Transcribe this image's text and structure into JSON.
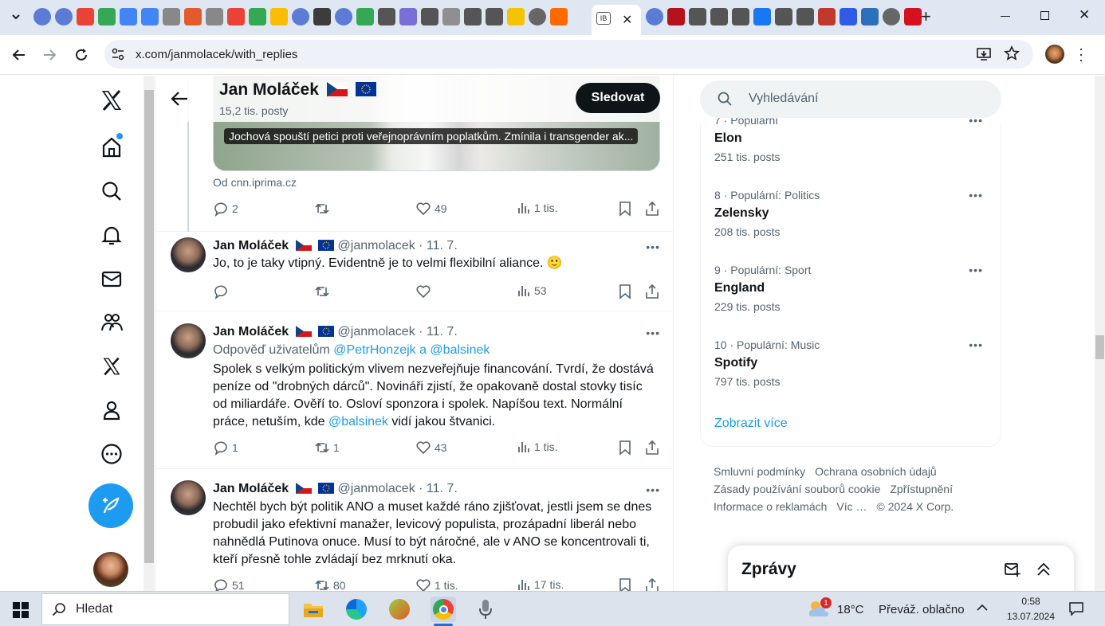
{
  "browser": {
    "url": "x.com/janmolacek/with_replies",
    "tab_favicons": [
      {
        "icon": "globe-icon",
        "color": "#5b7bd5"
      },
      {
        "icon": "globe-icon",
        "color": "#5b7bd5"
      },
      {
        "icon": "gmail-icon",
        "color": "#ea4335"
      },
      {
        "icon": "drive-icon",
        "color": "#34a853"
      },
      {
        "icon": "docs-icon",
        "color": "#4285f4"
      },
      {
        "icon": "docs-icon",
        "color": "#4285f4"
      },
      {
        "icon": "site-icon",
        "color": "#888888"
      },
      {
        "icon": "site-icon",
        "color": "#e35b2d"
      },
      {
        "icon": "site-icon",
        "color": "#888888"
      },
      {
        "icon": "gmail-icon",
        "color": "#ea4335"
      },
      {
        "icon": "drive-icon",
        "color": "#34a853"
      },
      {
        "icon": "drive-icon",
        "color": "#fbbc04"
      },
      {
        "icon": "globe-icon",
        "color": "#5b7bd5"
      },
      {
        "icon": "site-icon",
        "color": "#3c3c3c"
      },
      {
        "icon": "globe-icon",
        "color": "#5b7bd5"
      },
      {
        "icon": "drive-icon",
        "color": "#34a853"
      },
      {
        "icon": "site-icon",
        "color": "#555555"
      },
      {
        "icon": "site-icon",
        "color": "#7a6fd6"
      },
      {
        "icon": "site-icon",
        "color": "#555555"
      },
      {
        "icon": "site-icon",
        "color": "#8f8f8f"
      },
      {
        "icon": "site-icon",
        "color": "#555555"
      },
      {
        "icon": "site-icon",
        "color": "#555555"
      },
      {
        "icon": "site-icon",
        "color": "#f5c400"
      },
      {
        "icon": "globe-icon",
        "color": "#666666"
      },
      {
        "icon": "site-icon",
        "color": "#ff6a00"
      }
    ],
    "tab_favicons_right": [
      {
        "icon": "globe-icon",
        "color": "#5b7bd5"
      },
      {
        "icon": "site-icon",
        "color": "#b5121b"
      },
      {
        "icon": "site-icon",
        "color": "#555555"
      },
      {
        "icon": "site-icon",
        "color": "#555555"
      },
      {
        "icon": "site-icon",
        "color": "#555555"
      },
      {
        "icon": "facebook-icon",
        "color": "#1877f2"
      },
      {
        "icon": "site-icon",
        "color": "#555555"
      },
      {
        "icon": "site-icon",
        "color": "#555555"
      },
      {
        "icon": "site-icon",
        "color": "#c0392b"
      },
      {
        "icon": "site-icon",
        "color": "#2f5be6"
      },
      {
        "icon": "site-icon",
        "color": "#2c6fbb"
      },
      {
        "icon": "globe-icon",
        "color": "#666666"
      },
      {
        "icon": "site-icon",
        "color": "#d4121d"
      }
    ],
    "active_tab_label": "IB",
    "add_tab": "+"
  },
  "profile": {
    "name": "Jan Moláček",
    "posts": "15,2 tis. posty",
    "follow_label": "Sledovat"
  },
  "link_card": {
    "caption": "Jochová spouští petici proti veřejnoprávním poplatkům. Zmínila i transgender ak...",
    "source": "Od cnn.iprima.cz",
    "replies": "2",
    "likes": "49",
    "views": "1 tis."
  },
  "tweets": [
    {
      "name": "Jan Moláček",
      "handle": "@janmolacek",
      "date": "· 11. 7.",
      "text": "Jo, to je taky vtipný. Evidentně je to velmi flexibilní aliance. 🙂",
      "replies": "",
      "reposts": "",
      "likes": "",
      "views": "53"
    },
    {
      "name": "Jan Moláček",
      "handle": "@janmolacek",
      "date": "· 11. 7.",
      "reply_prefix": "Odpověď uživatelům",
      "reply_to": "@PetrHonzejk a @balsinek",
      "text_a": "Spolek s velkým politickým vlivem nezveřejňuje financování. Tvrdí, že dostává peníze od \"drobných dárců\". Novináři zjistí, že opakovaně dostal stovky tisíc od miliardáře. Ověří to. Osloví sponzora i spolek. Napíšou text. Normální práce, netuším, kde ",
      "mention": "@balsinek",
      "text_b": " vidí jakou štvanici.",
      "replies": "1",
      "reposts": "1",
      "likes": "43",
      "views": "1 tis."
    },
    {
      "name": "Jan Moláček",
      "handle": "@janmolacek",
      "date": "· 11. 7.",
      "text": "Nechtěl bych být politik ANO a muset každé ráno zjišťovat, jestli jsem se dnes probudil jako efektivní manažer, levicový populista, prozápadní liberál nebo nahnědlá Putinova onuce. Musí to být náročné, ale v ANO se koncentrovali ti, kteří přesně tohle zvládají bez mrknutí oka.",
      "replies": "51",
      "reposts": "80",
      "likes": "1 tis.",
      "views": "17 tis."
    }
  ],
  "search": {
    "placeholder": "Vyhledávání"
  },
  "trends": [
    {
      "meta": "7 · Populární",
      "name": "Elon",
      "count": "251 tis. posts"
    },
    {
      "meta": "8 · Populární: Politics",
      "name": "Zelensky",
      "count": "208 tis. posts"
    },
    {
      "meta": "9 · Populární: Sport",
      "name": "England",
      "count": "229 tis. posts"
    },
    {
      "meta": "10 · Populární: Music",
      "name": "Spotify",
      "count": "797 tis. posts"
    }
  ],
  "show_more": "Zobrazit více",
  "footer": {
    "terms": "Smluvní podmínky",
    "privacy": "Ochrana osobních údajů",
    "cookies": "Zásady používání souborů cookie",
    "accessibility": "Zpřístupnění",
    "ads": "Informace o reklamách",
    "more": "Víc …",
    "copyright": "© 2024 X Corp."
  },
  "messages": {
    "title": "Zprávy"
  },
  "taskbar": {
    "search": "Hledat",
    "weather_temp": "18°C",
    "weather_text": "Převáž. oblačno",
    "weather_badge": "1",
    "time": "0:58",
    "date": "13.07.2024"
  },
  "colors": {
    "accent": "#1d9bf0",
    "text": "#0f1419",
    "muted": "#536471"
  }
}
